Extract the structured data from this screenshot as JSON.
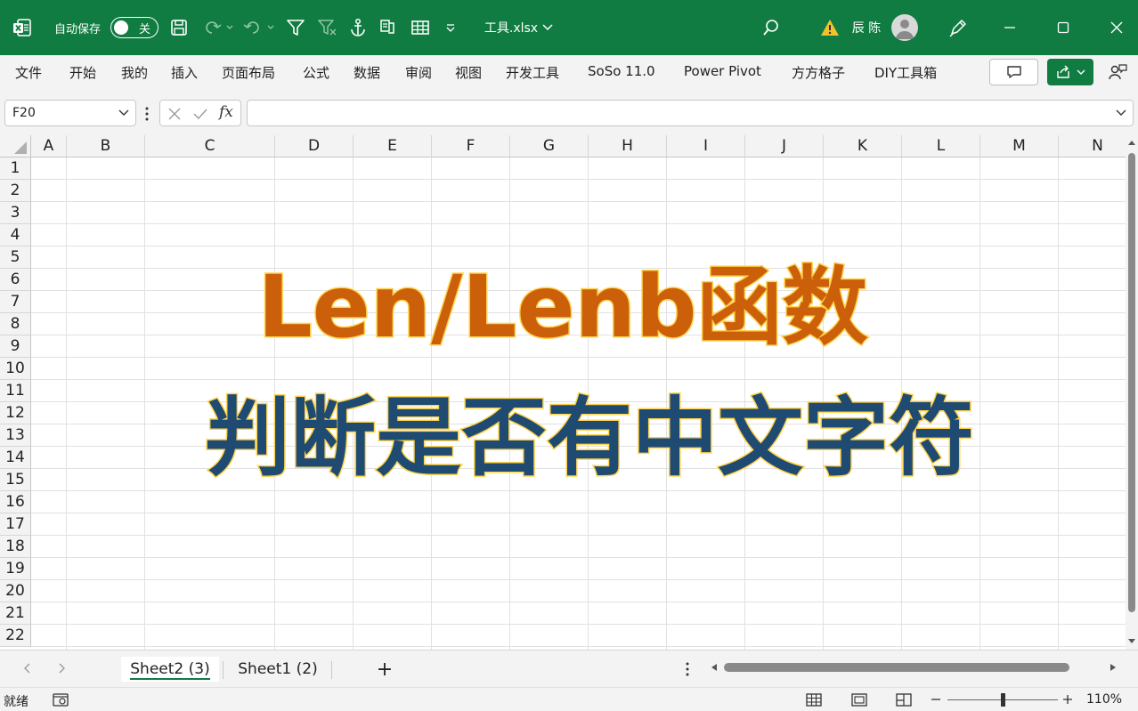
{
  "titlebar": {
    "autosave_label": "自动保存",
    "autosave_state": "关",
    "filename": "工具.xlsx",
    "user_name": "辰 陈"
  },
  "ribbon": {
    "tabs": [
      "文件",
      "开始",
      "我的",
      "插入",
      "页面布局",
      "公式",
      "数据",
      "审阅",
      "视图",
      "开发工具",
      "SoSo 11.0",
      "Power Pivot",
      "方方格子",
      "DIY工具箱"
    ]
  },
  "formula_bar": {
    "name_box": "F20",
    "fx_label": "fx",
    "formula": ""
  },
  "grid": {
    "columns": [
      "A",
      "B",
      "C",
      "D",
      "E",
      "F",
      "G",
      "H",
      "I",
      "J",
      "K",
      "L",
      "M",
      "N"
    ],
    "rows": [
      "1",
      "2",
      "3",
      "4",
      "5",
      "6",
      "7",
      "8",
      "9",
      "10",
      "11",
      "12",
      "13",
      "14",
      "15",
      "16",
      "17",
      "18",
      "19",
      "20",
      "21",
      "22"
    ]
  },
  "overlay": {
    "title_line1": "Len/Lenb函数",
    "title_line2": "判断是否有中文字符",
    "colors": {
      "line1_fill": "#cc5f0a",
      "line2_fill": "#1f4b72",
      "outline": "#ffd34d"
    }
  },
  "sheets": {
    "tabs": [
      {
        "label": "Sheet2 (3)",
        "active": true
      },
      {
        "label": "Sheet1 (2)",
        "active": false
      }
    ],
    "add_label": "+"
  },
  "statusbar": {
    "status": "就绪",
    "zoom": "110%"
  },
  "theme": {
    "accent": "#107c41"
  }
}
